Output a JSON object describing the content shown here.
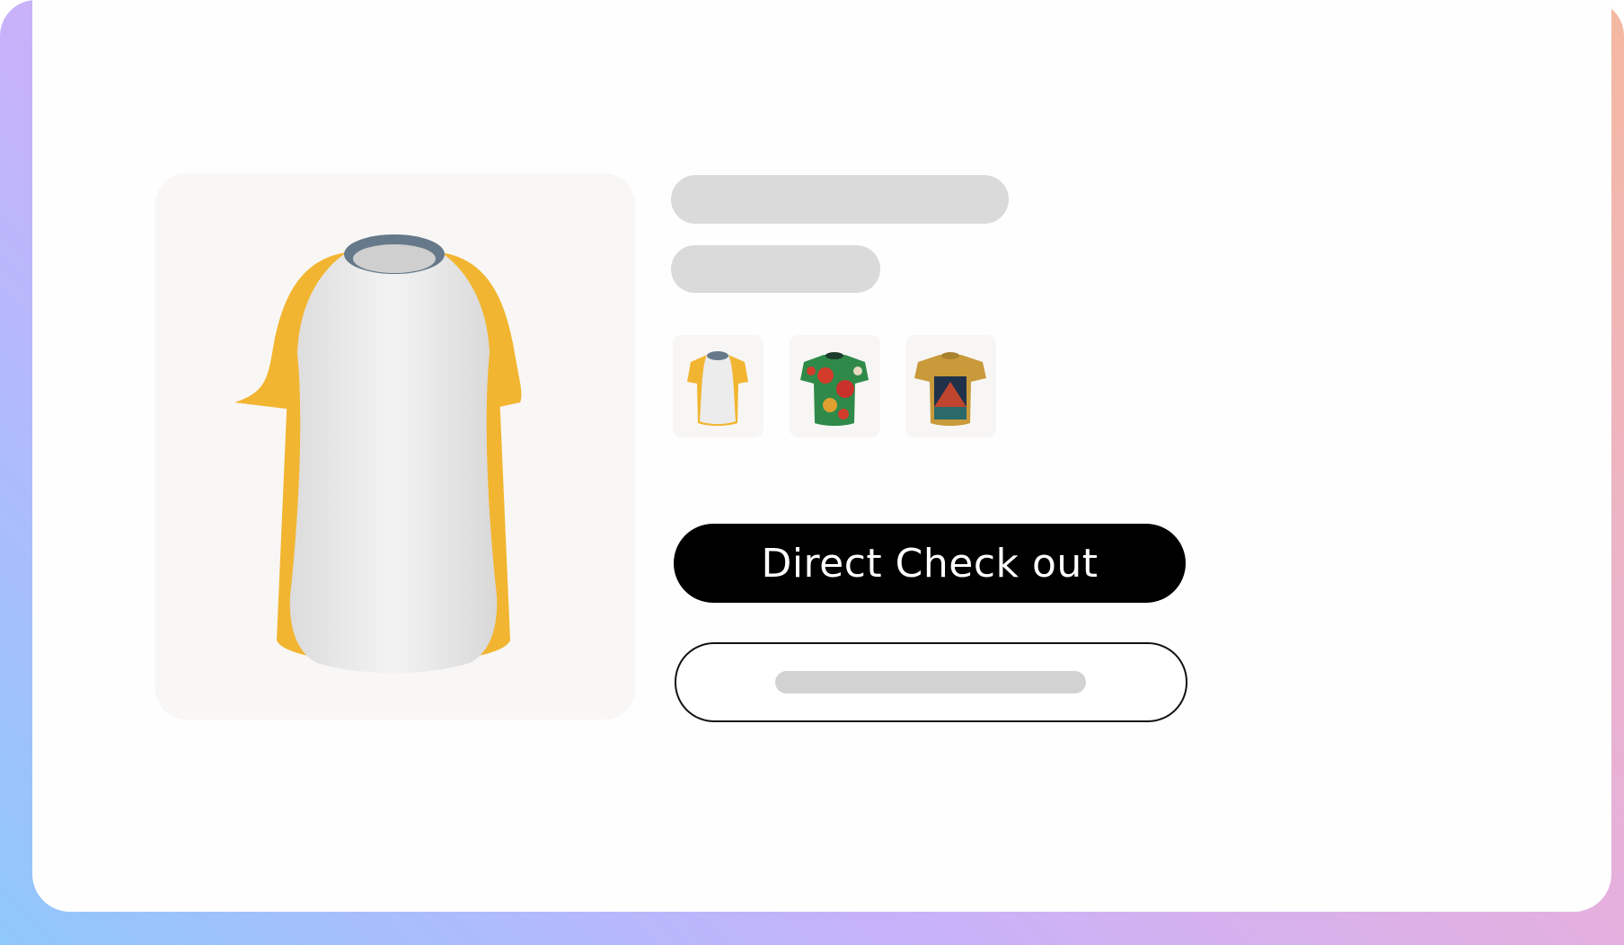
{
  "product": {
    "main_image": "raglan-tshirt-white-yellow",
    "thumbnails": [
      {
        "name": "raglan-tshirt-white-yellow",
        "selected": true
      },
      {
        "name": "tropical-print-tshirt",
        "selected": false
      },
      {
        "name": "mustard-mountain-print-tshirt",
        "selected": false
      }
    ]
  },
  "actions": {
    "checkout_label": "Direct Check out"
  },
  "colors": {
    "button_primary": "#000000",
    "skeleton": "#dadada",
    "gradient": [
      "#8fc8fb",
      "#c6b2fb",
      "#e6b0dd",
      "#f5b9a0"
    ]
  }
}
